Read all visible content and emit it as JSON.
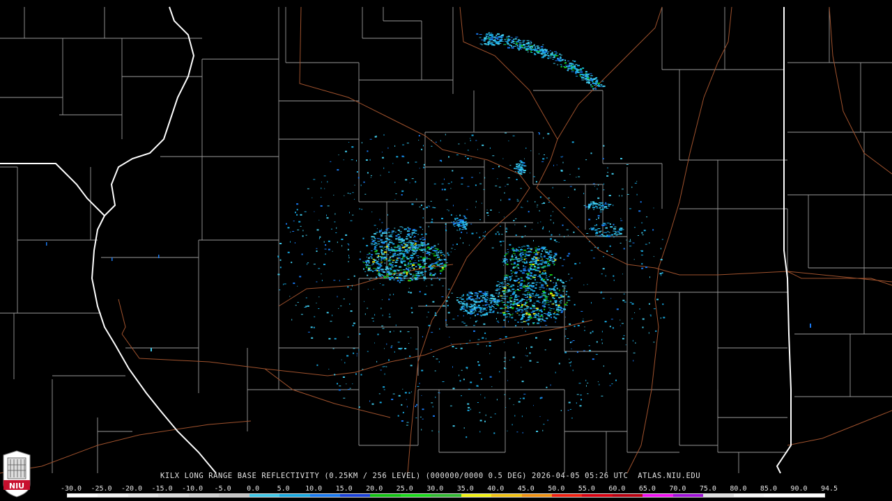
{
  "radar": {
    "site": "KILX",
    "product": "LONG RANGE BASE REFLECTIVITY",
    "caption": "KILX LONG RANGE BASE REFLECTIVITY (0.25KM / 256 LEVEL) (000000/0000 0.5 DEG) 2026-04-05 05:26 UTC  ATLAS.NIU.EDU",
    "resolution": "0.25KM / 256 LEVEL",
    "elevation": "0.5 DEG",
    "timestamp": "2026-04-05 05:26 UTC",
    "source": "ATLAS.NIU.EDU"
  },
  "scale": {
    "labels": [
      "-30.0",
      "-25.0",
      "-20.0",
      "-15.0",
      "-10.0",
      "-5.0",
      "0.0",
      "5.0",
      "10.0",
      "15.0",
      "20.0",
      "25.0",
      "30.0",
      "35.0",
      "40.0",
      "45.0",
      "50.0",
      "55.0",
      "60.0",
      "65.0",
      "70.0",
      "75.0",
      "80.0",
      "85.0",
      "90.0",
      "94.5"
    ],
    "colors": [
      "#ffffff",
      "#f4f4f4",
      "#e8e8e8",
      "#dcdcdc",
      "#d0d0d0",
      "#c4c4c4",
      "#40c8e8",
      "#18a8e0",
      "#1878f0",
      "#1840d8",
      "#10c010",
      "#18d818",
      "#30b830",
      "#f0f010",
      "#f0c010",
      "#f09010",
      "#f02010",
      "#d80010",
      "#b80010",
      "#f010f0",
      "#a010d8",
      "#e0e0e0",
      "#f8f8f8",
      "#ffffff",
      "#ffffff"
    ]
  },
  "colors": {
    "background": "#000000",
    "county_lines": "#9a9a9a",
    "state_lines": "#ffffff",
    "highways": "#a0522d"
  },
  "logo": {
    "text": "NIU",
    "color": "#c8102e"
  }
}
